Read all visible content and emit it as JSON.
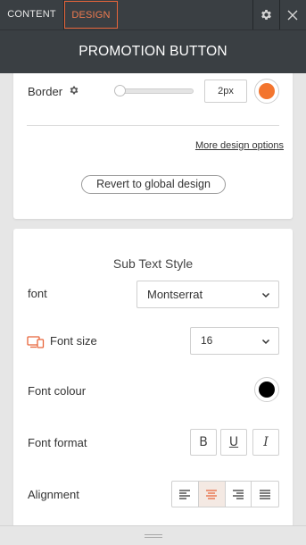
{
  "tabs": {
    "content": "CONTENT",
    "design": "DESIGN"
  },
  "panel_title": "PROMOTION BUTTON",
  "border": {
    "label": "Border",
    "width_value": "2px",
    "color": "#f3752e",
    "slider_value": 0
  },
  "links": {
    "more_design": "More design options",
    "revert": "Revert to global design"
  },
  "sub_text": {
    "heading": "Sub Text Style",
    "font_label": "font",
    "font_value": "Montserrat",
    "size_label": "Font size",
    "size_value": "16",
    "colour_label": "Font colour",
    "colour_value": "#000000",
    "format_label": "Font format",
    "format_buttons": {
      "bold": "B",
      "underline": "U",
      "italic": "I"
    },
    "alignment_label": "Alignment",
    "alignment_selected": "center"
  },
  "colors": {
    "accent": "#e8653a",
    "topbar": "#3a3f43"
  }
}
